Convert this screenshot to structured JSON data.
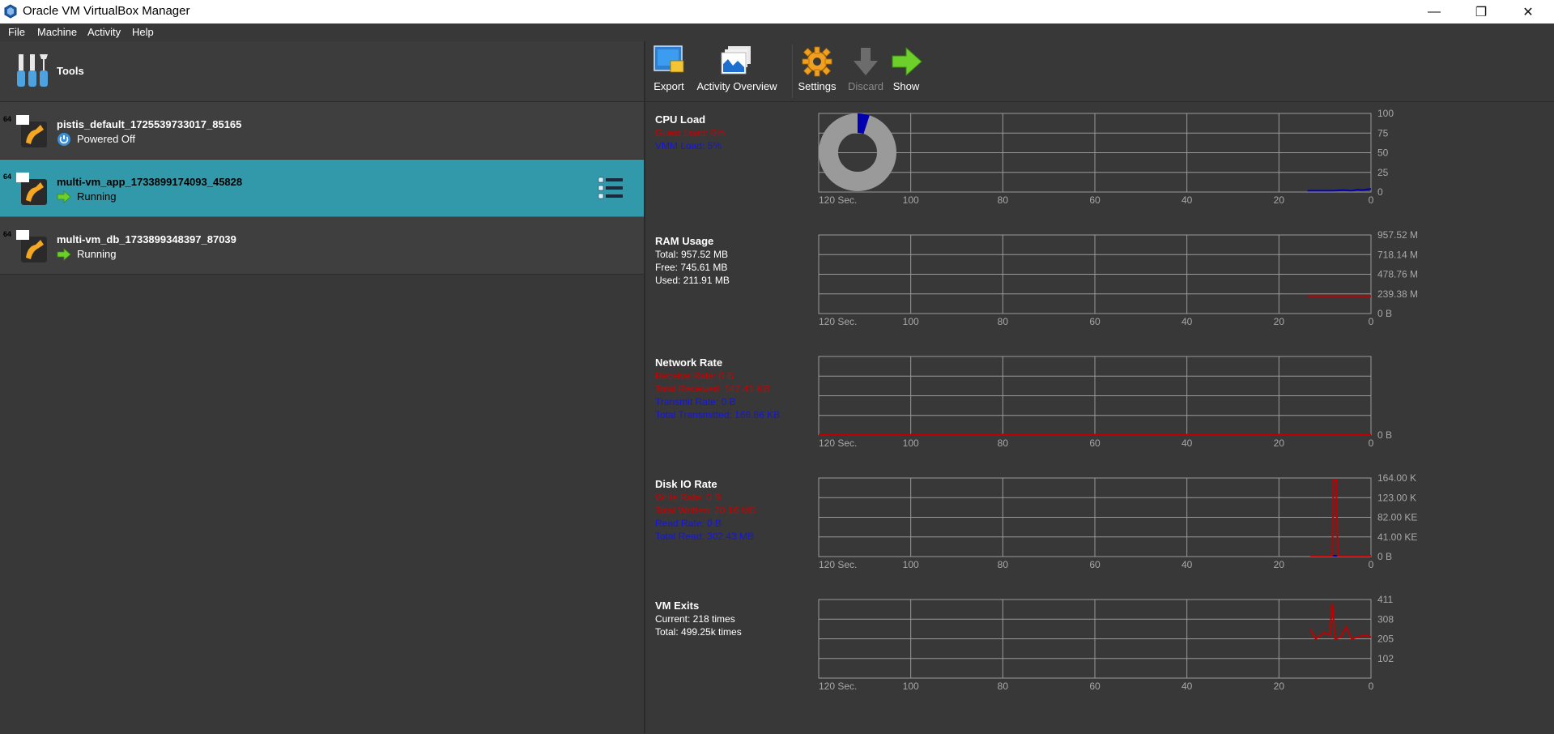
{
  "window": {
    "title": "Oracle VM VirtualBox Manager",
    "minimize": "—",
    "maximize": "❐",
    "close": "✕"
  },
  "menu": [
    "File",
    "Machine",
    "Activity",
    "Help"
  ],
  "tools": {
    "label": "Tools"
  },
  "vms": [
    {
      "name": "pistis_default_1725539733017_85165",
      "state": "Powered Off",
      "badge": "64"
    },
    {
      "name": "multi-vm_app_1733899174093_45828",
      "state": "Running",
      "badge": "64"
    },
    {
      "name": "multi-vm_db_1733899348397_87039",
      "state": "Running",
      "badge": "64"
    }
  ],
  "toolbar": {
    "export": "Export",
    "activity": "Activity Overview",
    "settings": "Settings",
    "discard": "Discard",
    "show": "Show"
  },
  "x_axis": [
    "120 Sec.",
    "100",
    "80",
    "60",
    "40",
    "20",
    "0"
  ],
  "metrics": {
    "cpu": {
      "title": "CPU Load",
      "l1": "Guest Load: 0%",
      "l2": "VMM Load: 5%",
      "y": [
        "100",
        "75",
        "50",
        "25",
        "0"
      ]
    },
    "ram": {
      "title": "RAM Usage",
      "l1": "Total: 957.52 MB",
      "l2": "Free: 745.61 MB",
      "l3": "Used: 211.91 MB",
      "y": [
        "957.52 M",
        "718.14 M",
        "478.76 M",
        "239.38 M",
        "0 B"
      ]
    },
    "net": {
      "title": "Network Rate",
      "l1": "Receive Rate: 0 B",
      "l2": "Total Received: 147.41 KB",
      "l3": "Transmit Rate: 0 B",
      "l4": "Total Transmitted: 166.86 KB",
      "y": [
        "",
        "",
        "",
        "",
        "0 B"
      ]
    },
    "disk": {
      "title": "Disk IO Rate",
      "l1": "Write Rate: 0 B",
      "l2": "Total Written: 20.16 MB",
      "l3": "Read Rate: 0 B",
      "l4": "Total Read: 302.43 MB",
      "y": [
        "164.00 K",
        "123.00 K",
        "82.00 KE",
        "41.00 KE",
        "0 B"
      ]
    },
    "exits": {
      "title": "VM Exits",
      "l1": "Current: 218 times",
      "l2": "Total: 499.25k times",
      "y": [
        "411",
        "308",
        "205",
        "102",
        ""
      ]
    }
  },
  "colors": {
    "selected": "#3199a9",
    "red_series": "#c00000",
    "blue_series": "#0000b0",
    "grid": "#9a9a9a"
  }
}
